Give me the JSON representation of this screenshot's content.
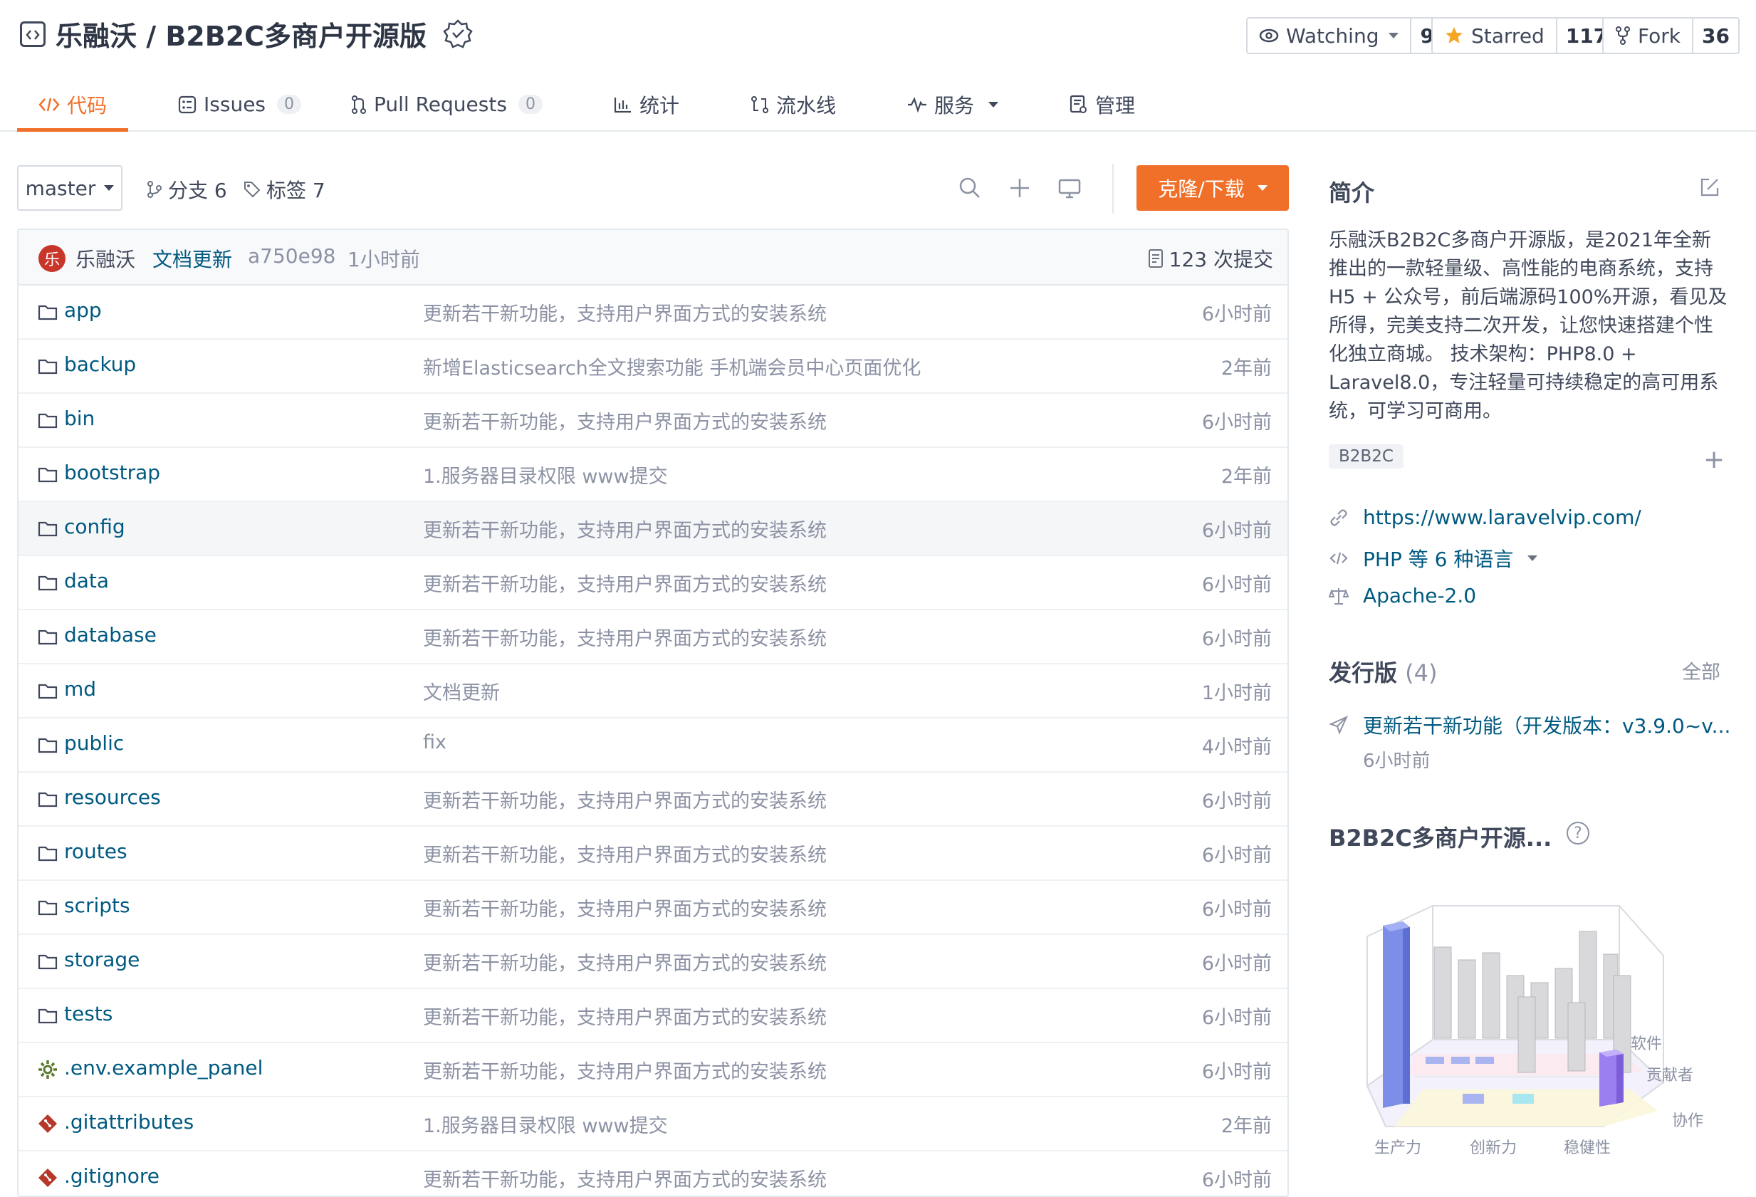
{
  "repo": {
    "title": "乐融沃 / B2B2C多商户开源版",
    "watch": {
      "label": "Watching",
      "count": "9"
    },
    "star": {
      "label": "Starred",
      "count": "117"
    },
    "fork": {
      "label": "Fork",
      "count": "36"
    }
  },
  "tabs": [
    {
      "label": "代码",
      "icon": "code-icon"
    },
    {
      "label": "Issues",
      "badge": "0",
      "icon": "issues-icon"
    },
    {
      "label": "Pull Requests",
      "badge": "0",
      "icon": "pull-request-icon"
    },
    {
      "label": "统计",
      "icon": "stats-icon"
    },
    {
      "label": "流水线",
      "icon": "pipeline-icon"
    },
    {
      "label": "服务",
      "icon": "service-icon"
    },
    {
      "label": "管理",
      "icon": "manage-icon"
    }
  ],
  "toolbar": {
    "branch": "master",
    "branches": "分支 6",
    "tags": "标签 7",
    "clone": "克隆/下载"
  },
  "commit": {
    "avatar_char": "乐",
    "author": "乐融沃",
    "message": "文档更新",
    "sha": "a750e98",
    "time": "1小时前",
    "count": "123 次提交"
  },
  "files": [
    {
      "name": "app",
      "type": "folder",
      "msg": "更新若干新功能，支持用户界面方式的安装系统",
      "time": "6小时前"
    },
    {
      "name": "backup",
      "type": "folder",
      "msg": "新增Elasticsearch全文搜索功能 手机端会员中心页面优化",
      "time": "2年前"
    },
    {
      "name": "bin",
      "type": "folder",
      "msg": "更新若干新功能，支持用户界面方式的安装系统",
      "time": "6小时前"
    },
    {
      "name": "bootstrap",
      "type": "folder",
      "msg": "1.服务器目录权限 www提交",
      "time": "2年前"
    },
    {
      "name": "config",
      "type": "folder",
      "msg": "更新若干新功能，支持用户界面方式的安装系统",
      "time": "6小时前"
    },
    {
      "name": "data",
      "type": "folder",
      "msg": "更新若干新功能，支持用户界面方式的安装系统",
      "time": "6小时前"
    },
    {
      "name": "database",
      "type": "folder",
      "msg": "更新若干新功能，支持用户界面方式的安装系统",
      "time": "6小时前"
    },
    {
      "name": "md",
      "type": "folder",
      "msg": "文档更新",
      "time": "1小时前"
    },
    {
      "name": "public",
      "type": "folder",
      "msg": "fix",
      "time": "4小时前"
    },
    {
      "name": "resources",
      "type": "folder",
      "msg": "更新若干新功能，支持用户界面方式的安装系统",
      "time": "6小时前"
    },
    {
      "name": "routes",
      "type": "folder",
      "msg": "更新若干新功能，支持用户界面方式的安装系统",
      "time": "6小时前"
    },
    {
      "name": "scripts",
      "type": "folder",
      "msg": "更新若干新功能，支持用户界面方式的安装系统",
      "time": "6小时前"
    },
    {
      "name": "storage",
      "type": "folder",
      "msg": "更新若干新功能，支持用户界面方式的安装系统",
      "time": "6小时前"
    },
    {
      "name": "tests",
      "type": "folder",
      "msg": "更新若干新功能，支持用户界面方式的安装系统",
      "time": "6小时前"
    },
    {
      "name": ".env.example_panel",
      "type": "gear",
      "msg": "更新若干新功能，支持用户界面方式的安装系统",
      "time": "6小时前"
    },
    {
      "name": ".gitattributes",
      "type": "git",
      "msg": "1.服务器目录权限 www提交",
      "time": "2年前"
    },
    {
      "name": ".gitignore",
      "type": "git",
      "msg": "更新若干新功能，支持用户界面方式的安装系统",
      "time": "6小时前"
    }
  ],
  "sidebar": {
    "intro_title": "简介",
    "description": "乐融沃B2B2C多商户开源版，是2021年全新推出的一款轻量级、高性能的电商系统，支持H5 + 公众号，前后端源码100%开源，看见及所得，完美支持二次开发，让您快速搭建个性化独立商城。 技术架构：PHP8.0 + Laravel8.0，专注轻量可持续稳定的高可用系统，可学习可商用。",
    "tag": "B2B2C",
    "website": "https://www.laravelvip.com/",
    "language": "PHP 等 6 种语言",
    "license": "Apache-2.0",
    "releases_title": "发行版",
    "releases_count": "(4)",
    "releases_all": "全部",
    "release_name": "更新若干新功能（开发版本：v3.9.0~v...",
    "release_time": "6小时前",
    "index_title": "B2B2C多商户开源...",
    "help": "?",
    "chart_labels": {
      "x": [
        "生产力",
        "创新力",
        "稳健性"
      ],
      "y": [
        "软件",
        "贡献者",
        "协作"
      ]
    }
  },
  "colors": {
    "accent": "#f0702a",
    "link": "#005980",
    "muted": "#8c92a4"
  }
}
